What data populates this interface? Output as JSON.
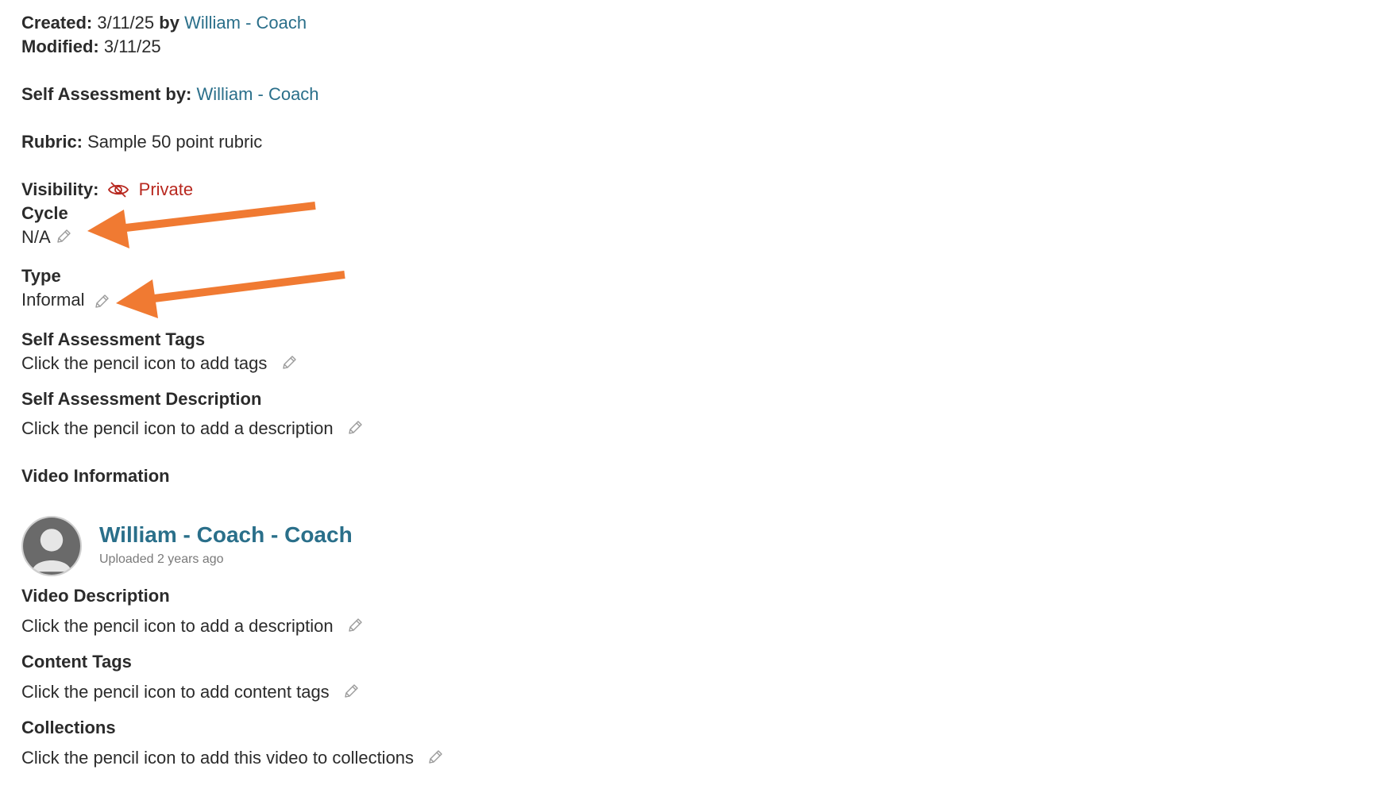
{
  "created": {
    "label": "Created:",
    "date": "3/11/25",
    "by_label": "by",
    "author": "William - Coach"
  },
  "modified": {
    "label": "Modified:",
    "date": "3/11/25"
  },
  "self_assessment_by": {
    "label": "Self Assessment by:",
    "value": "William - Coach"
  },
  "rubric": {
    "label": "Rubric:",
    "value": "Sample 50 point rubric"
  },
  "visibility": {
    "label": "Visibility:",
    "value": "Private",
    "icon": "eye-slash-icon",
    "color": "#b8281f"
  },
  "cycle": {
    "label": "Cycle",
    "value": "N/A"
  },
  "type": {
    "label": "Type",
    "value": "Informal"
  },
  "self_assessment_tags": {
    "label": "Self Assessment Tags",
    "value": "Click the pencil icon to add tags"
  },
  "self_assessment_description": {
    "label": "Self Assessment Description",
    "value": "Click the pencil icon to add a description"
  },
  "video_information": {
    "label": "Video Information",
    "author": "William - Coach - Coach",
    "uploaded": "Uploaded 2 years ago"
  },
  "video_description": {
    "label": "Video Description",
    "value": "Click the pencil icon to add a description"
  },
  "content_tags": {
    "label": "Content Tags",
    "value": "Click the pencil icon to add content tags"
  },
  "collections": {
    "label": "Collections",
    "value": "Click the pencil icon to add this video to collections"
  },
  "colors": {
    "link": "#2a6f8a",
    "private": "#b8281f",
    "annotation_arrow": "#f07a32"
  }
}
